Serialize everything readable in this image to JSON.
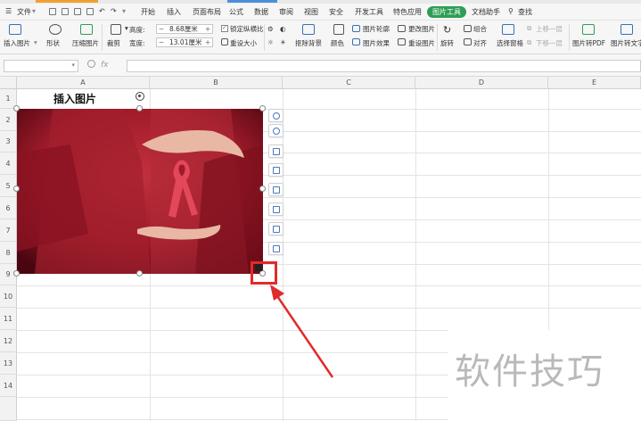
{
  "menu": {
    "file": "文件",
    "tabs": [
      "开始",
      "插入",
      "页面布局",
      "公式",
      "数据",
      "审阅",
      "视图",
      "安全",
      "开发工具",
      "特色应用",
      "图片工具",
      "文档助手"
    ],
    "active_tab": "图片工具",
    "search": "查找"
  },
  "ribbon": {
    "insert_picture": "插入图片",
    "shape": "形状",
    "compress": "压缩图片",
    "crop": "裁剪",
    "height_label": "高度:",
    "height_value": "8.68厘米",
    "width_label": "宽度:",
    "width_value": "13.01厘米",
    "lock_ratio": "锁定纵横比",
    "reset_size": "重设大小",
    "remove_bg": "抠除背景",
    "color": "颜色",
    "outline": "图片轮廓",
    "effects": "图片效果",
    "change_picture": "更改图片",
    "reset_picture": "重设图片",
    "rotate": "旋转",
    "group": "组合",
    "align": "对齐",
    "bring_forward": "上移一层",
    "send_backward": "下移一层",
    "selection_pane": "选择窗格",
    "to_pdf": "图片转PDF",
    "to_text": "图片转文字"
  },
  "formula_bar": {
    "fx": "fx",
    "name_box": "",
    "formula": ""
  },
  "sheet": {
    "columns": [
      "A",
      "B",
      "C",
      "D",
      "E"
    ],
    "rows": [
      "1",
      "2",
      "3",
      "4",
      "5",
      "6",
      "7",
      "8",
      "9",
      "10",
      "11",
      "12",
      "13",
      "14"
    ],
    "cell_a1": "插入图片"
  },
  "watermark": "软件技巧",
  "colors": {
    "accent_green": "#2e9e55",
    "annotation_red": "#e12a2a",
    "picture_red": "#b3212f"
  }
}
